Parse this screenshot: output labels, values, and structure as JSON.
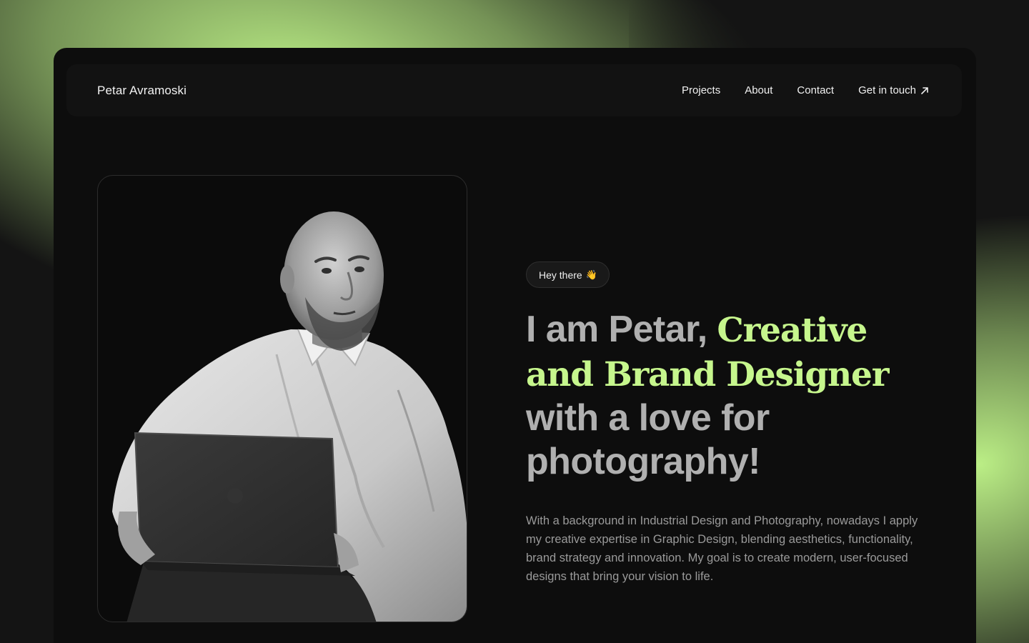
{
  "header": {
    "brand": "Petar Avramoski",
    "nav": {
      "projects": "Projects",
      "about": "About",
      "contact": "Contact",
      "get_in_touch": "Get in touch"
    }
  },
  "hero": {
    "badge_text": "Hey there",
    "badge_emoji": "👋",
    "headline_intro": "I am Petar, ",
    "headline_accent": "Creative and Brand Designer",
    "headline_outro": " with a love for photography!",
    "bio": "With a background in Industrial Design and Photography, nowadays I apply my creative expertise in Graphic Design, blending aesthetics, functionality, brand strategy and innovation. My goal is to create modern, user-focused designs that bring your vision to life."
  },
  "colors": {
    "accent": "#c6f68d",
    "background": "#0d0d0d",
    "glow": "#c4fa8c"
  },
  "icons": {
    "external_link": "arrow-up-right-icon",
    "wave": "waving-hand-icon"
  }
}
